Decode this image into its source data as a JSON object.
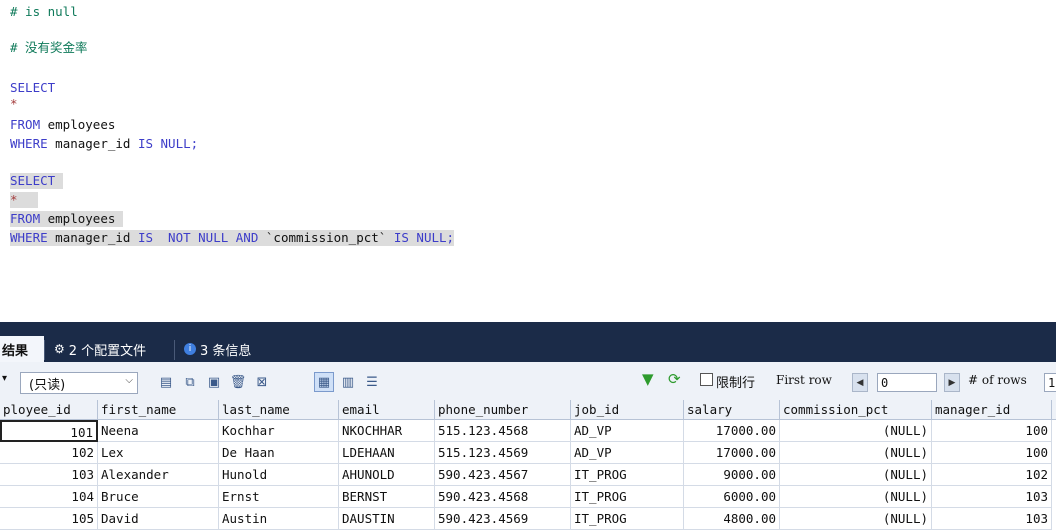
{
  "editor": {
    "lines": [
      {
        "text": "# is null",
        "cls": "cm"
      },
      {
        "text": "# 没有奖金率",
        "cls": "cm"
      },
      {
        "text": "SELECT",
        "cls": "kw"
      },
      {
        "text": "*",
        "cls": "st"
      },
      {
        "text": "FROM",
        "cls": "kw",
        "rest": " employees"
      },
      {
        "text": "WHERE",
        "cls": "kw",
        "rest": " manager_id ",
        "kw2": "IS NULL;"
      },
      {
        "text": "SELECT ",
        "cls": "kw"
      },
      {
        "text": "*",
        "cls": "st"
      },
      {
        "text": "FROM",
        "cls": "kw",
        "rest": " employees "
      },
      {
        "text": "WHERE",
        "cls": "kw",
        "rest": " manager_id ",
        "kw2": "IS  NOT NULL AND",
        "rest2": " `commission_pct` ",
        "kw3": "IS NULL;"
      }
    ]
  },
  "tabs": {
    "result": "结果",
    "profiles": "2 个配置文件",
    "info": "3 条信息"
  },
  "toolbar": {
    "readonly": "(只读)",
    "limit_label": "限制行",
    "first_row_label": "First row",
    "first_row_value": "0",
    "num_rows_label": "# of rows",
    "num_rows_value": "1"
  },
  "grid": {
    "headers": [
      "ployee_id",
      "first_name",
      "last_name",
      "email",
      "phone_number",
      "job_id",
      "salary",
      "commission_pct",
      "manager_id"
    ],
    "rows": [
      [
        "101",
        "Neena",
        "Kochhar",
        "NKOCHHAR",
        "515.123.4568",
        "AD_VP",
        "17000.00",
        "(NULL)",
        "100"
      ],
      [
        "102",
        "Lex",
        "De Haan",
        "LDEHAAN",
        "515.123.4569",
        "AD_VP",
        "17000.00",
        "(NULL)",
        "100"
      ],
      [
        "103",
        "Alexander",
        "Hunold",
        "AHUNOLD",
        "590.423.4567",
        "IT_PROG",
        "9000.00",
        "(NULL)",
        "102"
      ],
      [
        "104",
        "Bruce",
        "Ernst",
        "BERNST",
        "590.423.4568",
        "IT_PROG",
        "6000.00",
        "(NULL)",
        "103"
      ],
      [
        "105",
        "David",
        "Austin",
        "DAUSTIN",
        "590.423.4569",
        "IT_PROG",
        "4800.00",
        "(NULL)",
        "103"
      ]
    ]
  },
  "colors": {
    "keyword": "#3d3dc9",
    "comment": "#0f7a5a",
    "tabbar": "#1b2b48"
  }
}
